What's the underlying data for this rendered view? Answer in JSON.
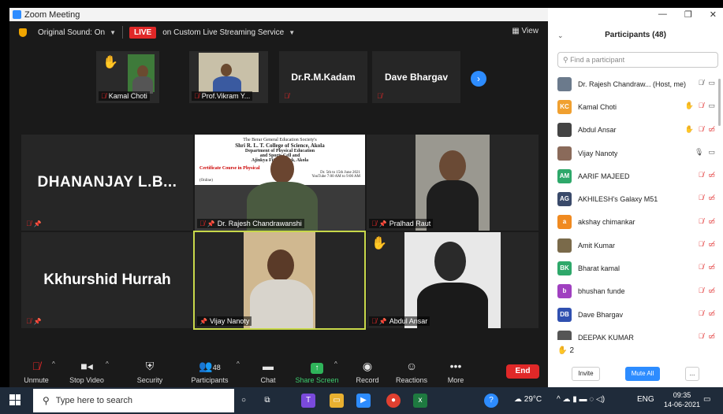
{
  "window": {
    "title": "Zoom Meeting"
  },
  "topbar": {
    "original_sound": "Original Sound: On",
    "live_badge": "LIVE",
    "live_service": "on Custom Live Streaming Service",
    "view": "View"
  },
  "strip": {
    "tiles": [
      {
        "name": "Kamal Choti"
      },
      {
        "name": "Prof.Vikram Y..."
      },
      {
        "name": "Dr.R.M.Kadam"
      },
      {
        "name": "Dave Bhargav"
      }
    ]
  },
  "gallery": {
    "tiles": [
      {
        "name": "DHANANJAY  L.B..."
      },
      {
        "name": "Dr. Rajesh Chandrawanshi"
      },
      {
        "name": "Pralhad Raut"
      },
      {
        "name": "Kkhurshid Hurrah"
      },
      {
        "name": "Vijay Nanoty"
      },
      {
        "name": "Abdul Ansar"
      }
    ],
    "poster": {
      "line1": "The Berar General Education Society's",
      "line2": "Shri R. L. T. College of Science, Akola",
      "line3": "Department of Physical Education",
      "line4": "and Sports Cell and",
      "line5": "Ajinkya Fitness Park, Akola",
      "line6": "Certificate Course in Physical",
      "line7": "Dr. 5th to 15th June 2021",
      "line8": "YouTube 7:00 AM to 9:00 AM",
      "line9": "(Online)"
    }
  },
  "toolbar": {
    "unmute": "Unmute",
    "stop_video": "Stop Video",
    "security": "Security",
    "participants": "Participants",
    "participants_count": "48",
    "chat": "Chat",
    "share_screen": "Share Screen",
    "record": "Record",
    "reactions": "Reactions",
    "more": "More",
    "end": "End"
  },
  "panel": {
    "title": "Participants (48)",
    "search_placeholder": "Find a participant",
    "participants": [
      {
        "name": "Dr. Rajesh Chandraw... (Host, me)",
        "initials": "",
        "color": "#6b7a8c"
      },
      {
        "name": "Kamal Choti",
        "initials": "KC",
        "color": "#f0a030"
      },
      {
        "name": "Abdul Ansar",
        "initials": "",
        "color": "#444444"
      },
      {
        "name": "Vijay Nanoty",
        "initials": "",
        "color": "#8a6a5a"
      },
      {
        "name": "AARIF MAJEED",
        "initials": "AM",
        "color": "#2ea86a"
      },
      {
        "name": "AKHILESH's Galaxy M51",
        "initials": "AG",
        "color": "#3a4a6a"
      },
      {
        "name": "akshay chimankar",
        "initials": "a",
        "color": "#f08a20"
      },
      {
        "name": "Amit Kumar",
        "initials": "",
        "color": "#7a6a4a"
      },
      {
        "name": "Bharat kamal",
        "initials": "BK",
        "color": "#2ea86a"
      },
      {
        "name": "bhushan funde",
        "initials": "b",
        "color": "#a040c0"
      },
      {
        "name": "Dave Bhargav",
        "initials": "DB",
        "color": "#3050b0"
      },
      {
        "name": "DEEPAK KUMAR",
        "initials": "",
        "color": "#555555"
      }
    ],
    "raised_hands": "2",
    "invite": "Invite",
    "mute_all": "Mute All",
    "more": "..."
  },
  "taskbar": {
    "search_placeholder": "Type here to search",
    "weather": "29°C",
    "language": "ENG",
    "time": "09:35",
    "date": "14-06-2021"
  }
}
